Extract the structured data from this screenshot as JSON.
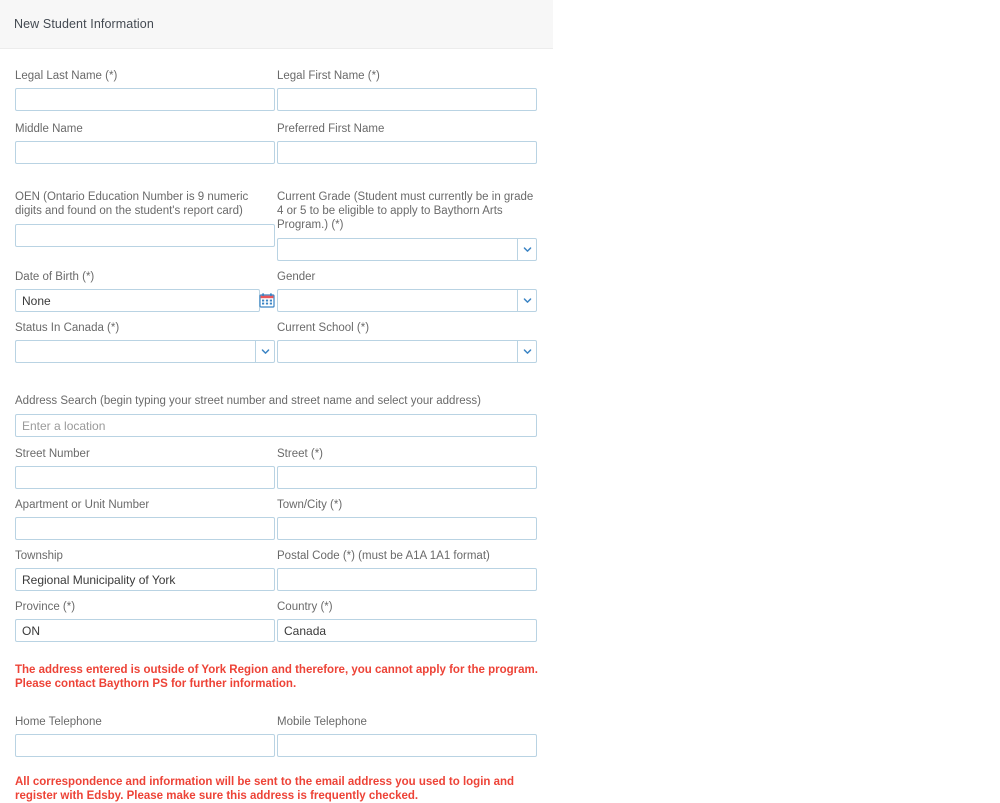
{
  "panel": {
    "title": "New Student Information",
    "header_bg": "#f7f7f7",
    "border_color": "#b9d3e3",
    "label_color": "#6a6a6a",
    "error_color": "#ed4337"
  },
  "fields": {
    "legal_last_name": {
      "label": "Legal Last Name (*)",
      "value": "",
      "placeholder": ""
    },
    "legal_first_name": {
      "label": "Legal First Name (*)",
      "value": "",
      "placeholder": ""
    },
    "middle_name": {
      "label": "Middle Name",
      "value": "",
      "placeholder": ""
    },
    "preferred_first_name": {
      "label": "Preferred First Name",
      "value": "",
      "placeholder": ""
    },
    "oen": {
      "label": "OEN (Ontario Education Number is 9 numeric digits and found on the student's report card)",
      "value": "",
      "placeholder": ""
    },
    "current_grade": {
      "label": "Current Grade (Student must currently be in grade 4 or 5 to be eligible to apply to Baythorn Arts Program.) (*)",
      "value": ""
    },
    "date_of_birth": {
      "label": "Date of Birth (*)",
      "value": "None"
    },
    "gender": {
      "label": "Gender",
      "value": ""
    },
    "status_in_canada": {
      "label": "Status In Canada (*)",
      "value": ""
    },
    "current_school": {
      "label": "Current School (*)",
      "value": ""
    },
    "address_search": {
      "label": "Address Search (begin typing your street number and street name and select your address)",
      "value": "",
      "placeholder": "Enter a location"
    },
    "street_number": {
      "label": "Street Number",
      "value": "",
      "placeholder": ""
    },
    "street": {
      "label": "Street (*)",
      "value": "",
      "placeholder": ""
    },
    "apartment_or_unit_number": {
      "label": "Apartment or Unit Number",
      "value": "",
      "placeholder": ""
    },
    "town_city": {
      "label": "Town/City (*)",
      "value": "",
      "placeholder": ""
    },
    "township": {
      "label": "Township",
      "value": "Regional Municipality of York",
      "placeholder": ""
    },
    "postal_code": {
      "label": "Postal Code (*) (must be A1A 1A1 format)",
      "value": "",
      "placeholder": ""
    },
    "province": {
      "label": "Province (*)",
      "value": "ON",
      "placeholder": ""
    },
    "country": {
      "label": "Country (*)",
      "value": "Canada",
      "placeholder": ""
    },
    "home_telephone": {
      "label": "Home Telephone",
      "value": "",
      "placeholder": ""
    },
    "mobile_telephone": {
      "label": "Mobile Telephone",
      "value": "",
      "placeholder": ""
    }
  },
  "messages": {
    "address_error": "The address entered is outside of York Region and therefore, you cannot apply for the program.  Please contact Baythorn PS for further information.",
    "email_notice": "All correspondence and information will be sent to the email address you used to login and register with Edsby.  Please make sure this address is frequently checked."
  },
  "icons": {
    "calendar": "calendar-icon",
    "chevron_down": "chevron-down-icon"
  }
}
